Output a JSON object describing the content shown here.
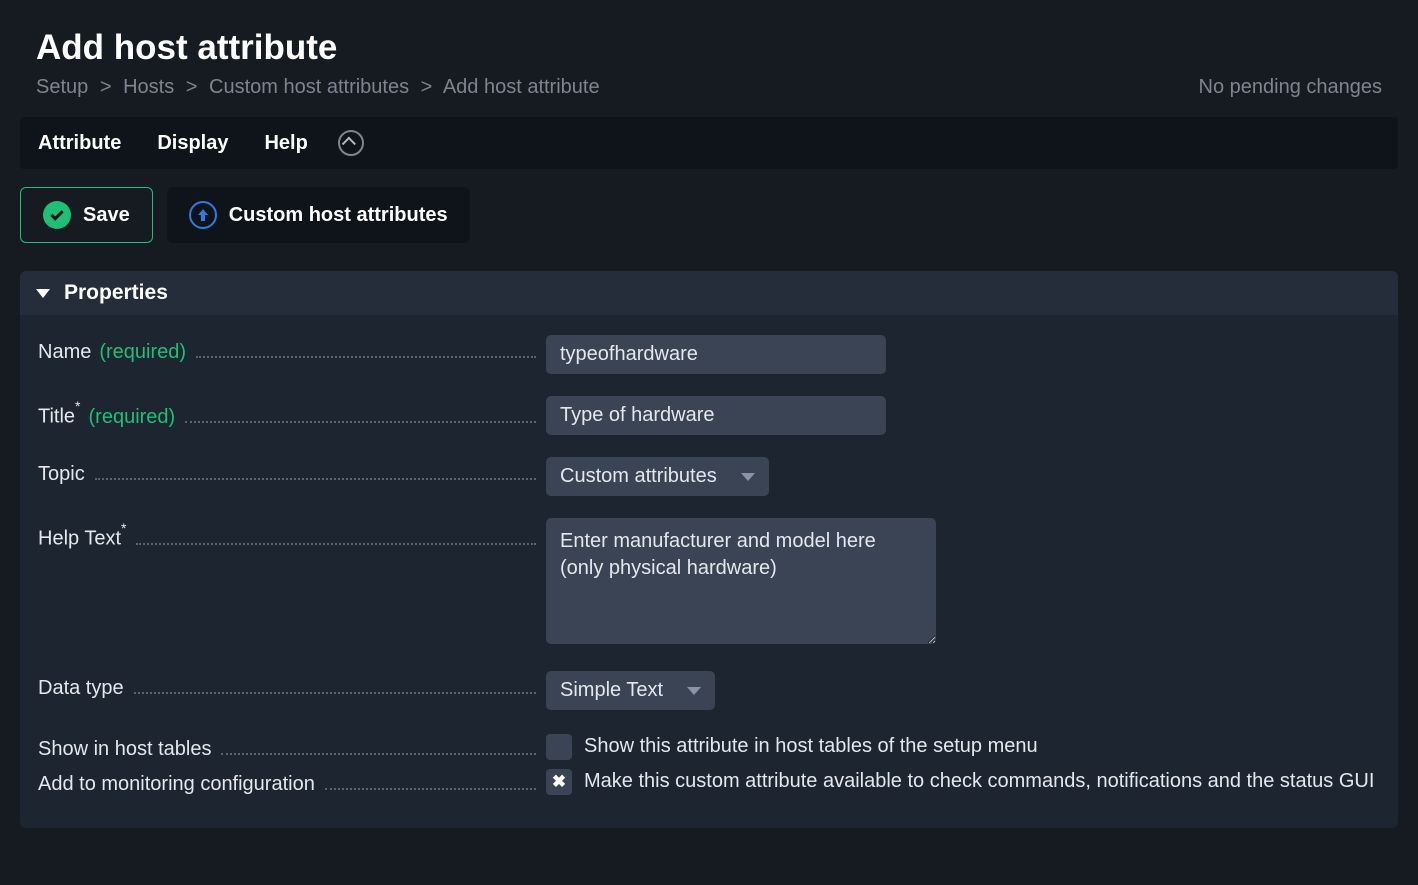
{
  "header": {
    "title": "Add host attribute",
    "breadcrumb": [
      "Setup",
      "Hosts",
      "Custom host attributes",
      "Add host attribute"
    ],
    "pending": "No pending changes"
  },
  "menubar": {
    "items": [
      "Attribute",
      "Display",
      "Help"
    ]
  },
  "actions": {
    "save": "Save",
    "back": "Custom host attributes"
  },
  "panel": {
    "title": "Properties"
  },
  "form": {
    "name": {
      "label": "Name",
      "required": "(required)",
      "value": "typeofhardware"
    },
    "title": {
      "label": "Title",
      "required": "(required)",
      "value": "Type of hardware"
    },
    "topic": {
      "label": "Topic",
      "value": "Custom attributes"
    },
    "help": {
      "label": "Help Text",
      "value": "Enter manufacturer and model here (only physical hardware)"
    },
    "datatype": {
      "label": "Data type",
      "value": "Simple Text"
    },
    "show_in_tables": {
      "label": "Show in host tables",
      "text": "Show this attribute in host tables of the setup menu",
      "checked": false
    },
    "add_to_monitoring": {
      "label": "Add to monitoring configuration",
      "text": "Make this custom attribute available to check commands, notifications and the status GUI",
      "checked": true
    }
  }
}
